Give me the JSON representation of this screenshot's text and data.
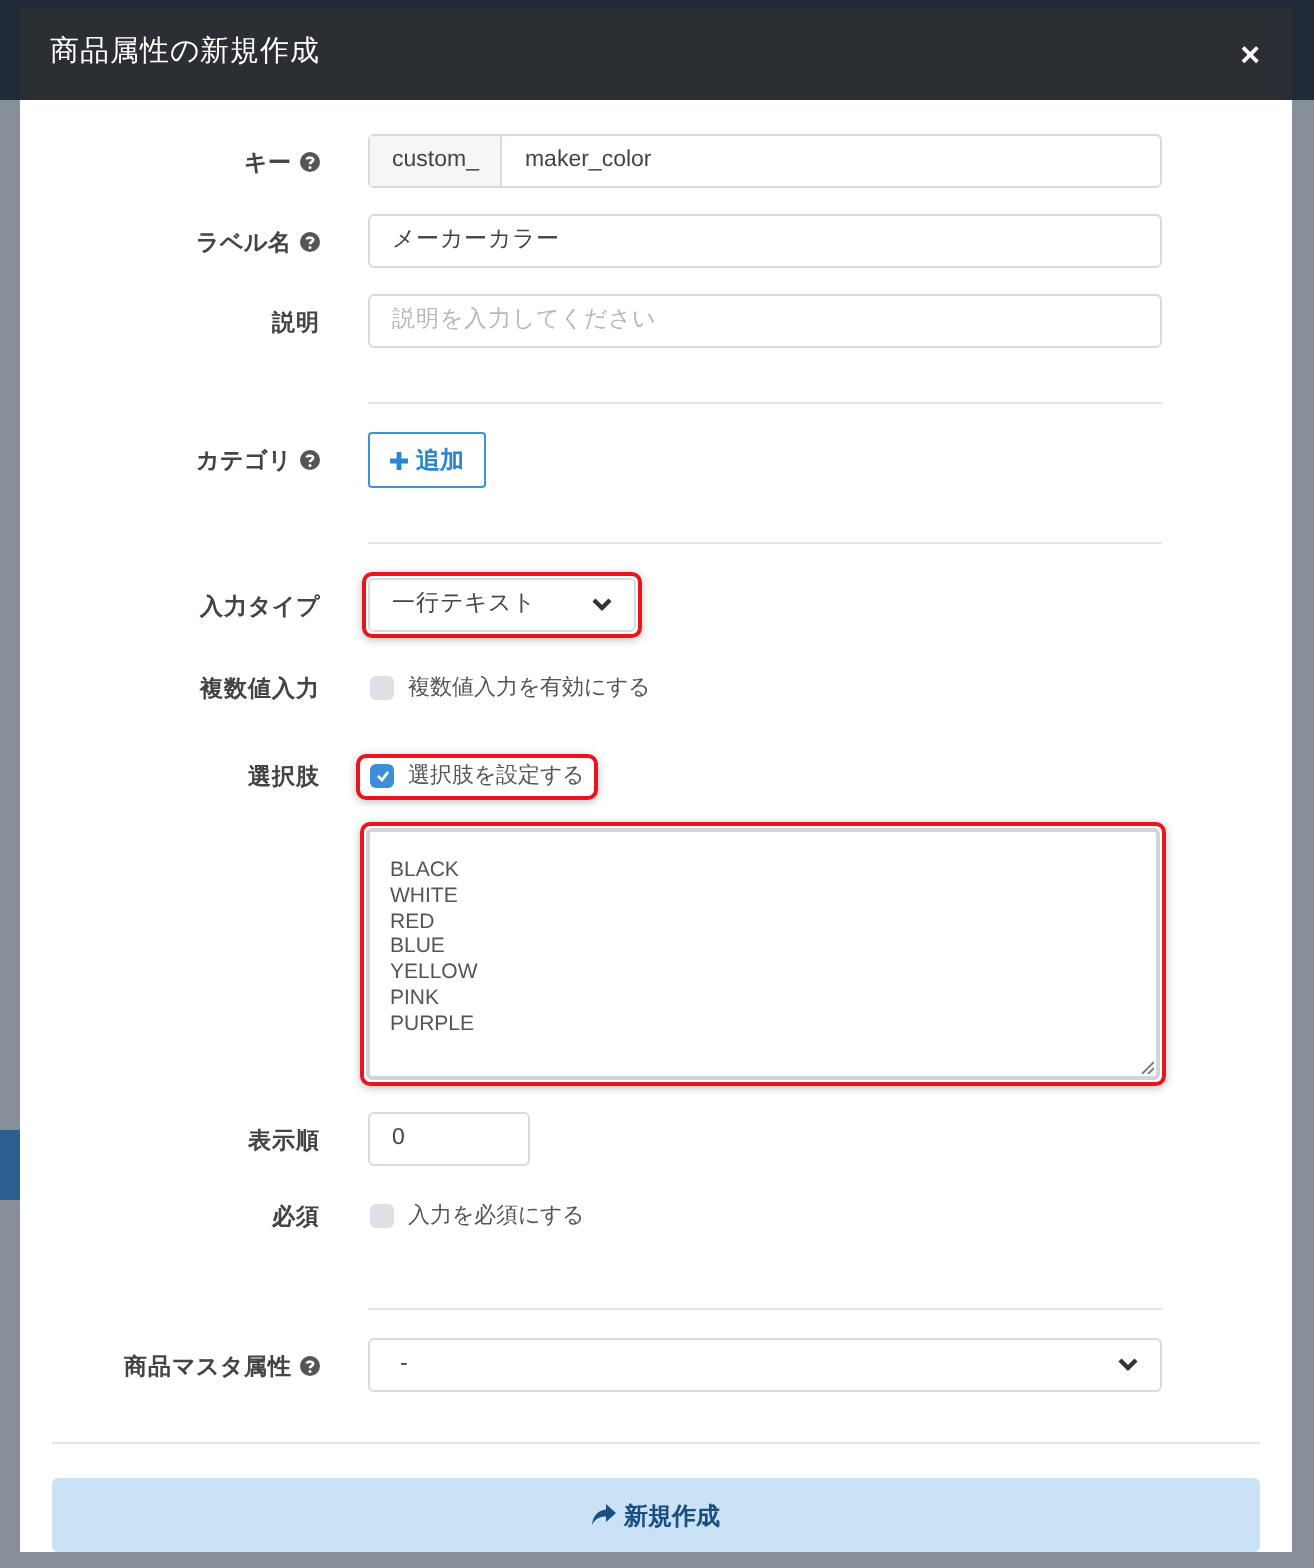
{
  "dialog": {
    "title": "商品属性の新規作成",
    "close": "×"
  },
  "fields": [
    {
      "kind": "prefixed",
      "label": "キー",
      "help": true,
      "prefix": "custom_",
      "value": "maker_color"
    },
    {
      "kind": "text",
      "label": "ラベル名",
      "help": true,
      "value": "メーカーカラー"
    },
    {
      "kind": "text",
      "label": "説明",
      "placeholder": "説明を入力してください"
    },
    {
      "kind": "divider"
    },
    {
      "kind": "add",
      "label": "カテゴリ",
      "help": true,
      "button": "追加"
    },
    {
      "kind": "divider"
    },
    {
      "kind": "select",
      "label": "入力タイプ",
      "value": "一行テキスト",
      "highlighted": true
    },
    {
      "kind": "checkbox",
      "label": "複数値入力",
      "text": "複数値入力を有効にする",
      "checked": false
    },
    {
      "kind": "checkbox",
      "label": "選択肢",
      "text": "選択肢を設定する",
      "checked": true,
      "highlighted": true
    },
    {
      "kind": "textarea",
      "lines": [
        "BLACK",
        "WHITE",
        "RED",
        "BLUE",
        "YELLOW",
        "PINK",
        "PURPLE"
      ],
      "highlighted": true
    },
    {
      "kind": "number",
      "label": "表示順",
      "value": "0"
    },
    {
      "kind": "checkbox",
      "label": "必須",
      "text": "入力を必須にする",
      "checked": false
    },
    {
      "kind": "divider"
    },
    {
      "kind": "wideselect",
      "label": "商品マスタ属性",
      "help": true,
      "value": "-"
    }
  ],
  "submit": {
    "label": "新規作成"
  }
}
